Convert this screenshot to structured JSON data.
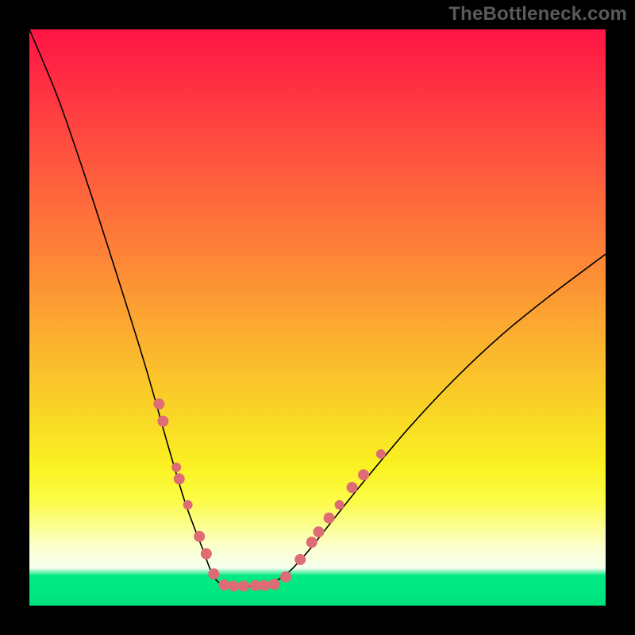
{
  "watermark": "TheBottleneck.com",
  "chart_data": {
    "type": "line",
    "title": "",
    "xlabel": "",
    "ylabel": "",
    "ylim": [
      0,
      100
    ],
    "series": [
      {
        "name": "curve",
        "x": [
          0.0,
          0.05,
          0.1,
          0.15,
          0.2,
          0.24,
          0.27,
          0.3,
          0.32,
          0.34,
          0.36,
          0.4,
          0.44,
          0.48,
          0.52,
          0.58,
          0.66,
          0.74,
          0.82,
          0.9,
          1.0
        ],
        "y": [
          100.0,
          88.0,
          73.5,
          58.0,
          42.0,
          28.0,
          18.0,
          10.0,
          5.0,
          3.5,
          3.4,
          3.5,
          5.0,
          9.0,
          14.0,
          21.5,
          31.0,
          39.5,
          47.0,
          53.5,
          61.0
        ]
      }
    ],
    "markers": {
      "name": "highlighted-points",
      "color": "#de6c74",
      "points": [
        {
          "x": 0.225,
          "y": 35.0,
          "r": 7
        },
        {
          "x": 0.232,
          "y": 32.0,
          "r": 7
        },
        {
          "x": 0.255,
          "y": 24.0,
          "r": 6
        },
        {
          "x": 0.26,
          "y": 22.0,
          "r": 7
        },
        {
          "x": 0.275,
          "y": 17.5,
          "r": 6
        },
        {
          "x": 0.295,
          "y": 12.0,
          "r": 7
        },
        {
          "x": 0.307,
          "y": 9.0,
          "r": 7
        },
        {
          "x": 0.32,
          "y": 5.5,
          "r": 7
        },
        {
          "x": 0.338,
          "y": 3.6,
          "r": 7
        },
        {
          "x": 0.355,
          "y": 3.4,
          "r": 7
        },
        {
          "x": 0.372,
          "y": 3.4,
          "r": 7
        },
        {
          "x": 0.392,
          "y": 3.5,
          "r": 7
        },
        {
          "x": 0.408,
          "y": 3.5,
          "r": 7
        },
        {
          "x": 0.425,
          "y": 3.7,
          "r": 7
        },
        {
          "x": 0.445,
          "y": 5.0,
          "r": 7
        },
        {
          "x": 0.47,
          "y": 8.0,
          "r": 7
        },
        {
          "x": 0.49,
          "y": 11.0,
          "r": 7
        },
        {
          "x": 0.502,
          "y": 12.8,
          "r": 7
        },
        {
          "x": 0.52,
          "y": 15.2,
          "r": 7
        },
        {
          "x": 0.538,
          "y": 17.5,
          "r": 6
        },
        {
          "x": 0.56,
          "y": 20.5,
          "r": 7
        },
        {
          "x": 0.58,
          "y": 22.7,
          "r": 7
        },
        {
          "x": 0.61,
          "y": 26.3,
          "r": 6
        }
      ]
    }
  }
}
